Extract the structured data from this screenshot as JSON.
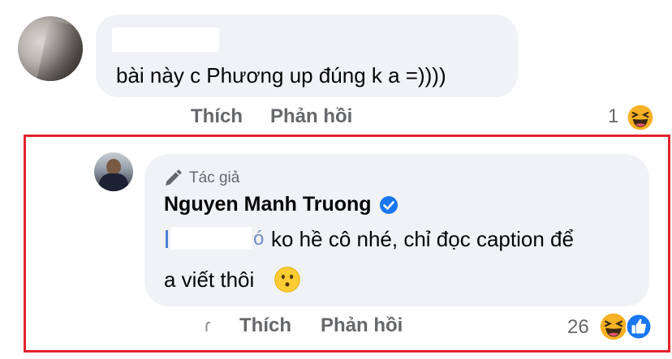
{
  "comment": {
    "text": "bài này c Phương up đúng k a =))))",
    "actions": {
      "like": "Thích",
      "reply": "Phản hồi"
    },
    "reaction_count": "1",
    "reaction_icon": "haha-icon"
  },
  "reply": {
    "badge_icon": "pencil-icon",
    "badge_label": "Tác giả",
    "author_name": "Nguyen Manh Truong",
    "verified_icon": "verified-badge-icon",
    "mention_tail": "ó",
    "text_line1": "ko hề cô nhé, chỉ đọc caption để",
    "text_line2": "a viết thôi",
    "inline_emoji": "hushed-face-emoji",
    "actions": {
      "like": "Thích",
      "reply": "Phản hồi"
    },
    "reaction_count": "26",
    "reaction_icons": [
      "haha-icon",
      "like-icon"
    ]
  },
  "colors": {
    "bubble": "#f0f2f5",
    "action_text": "#65676b",
    "highlight_border": "#e0242d",
    "verified_blue": "#1877f2",
    "reaction_yellow": "#f7b125"
  }
}
